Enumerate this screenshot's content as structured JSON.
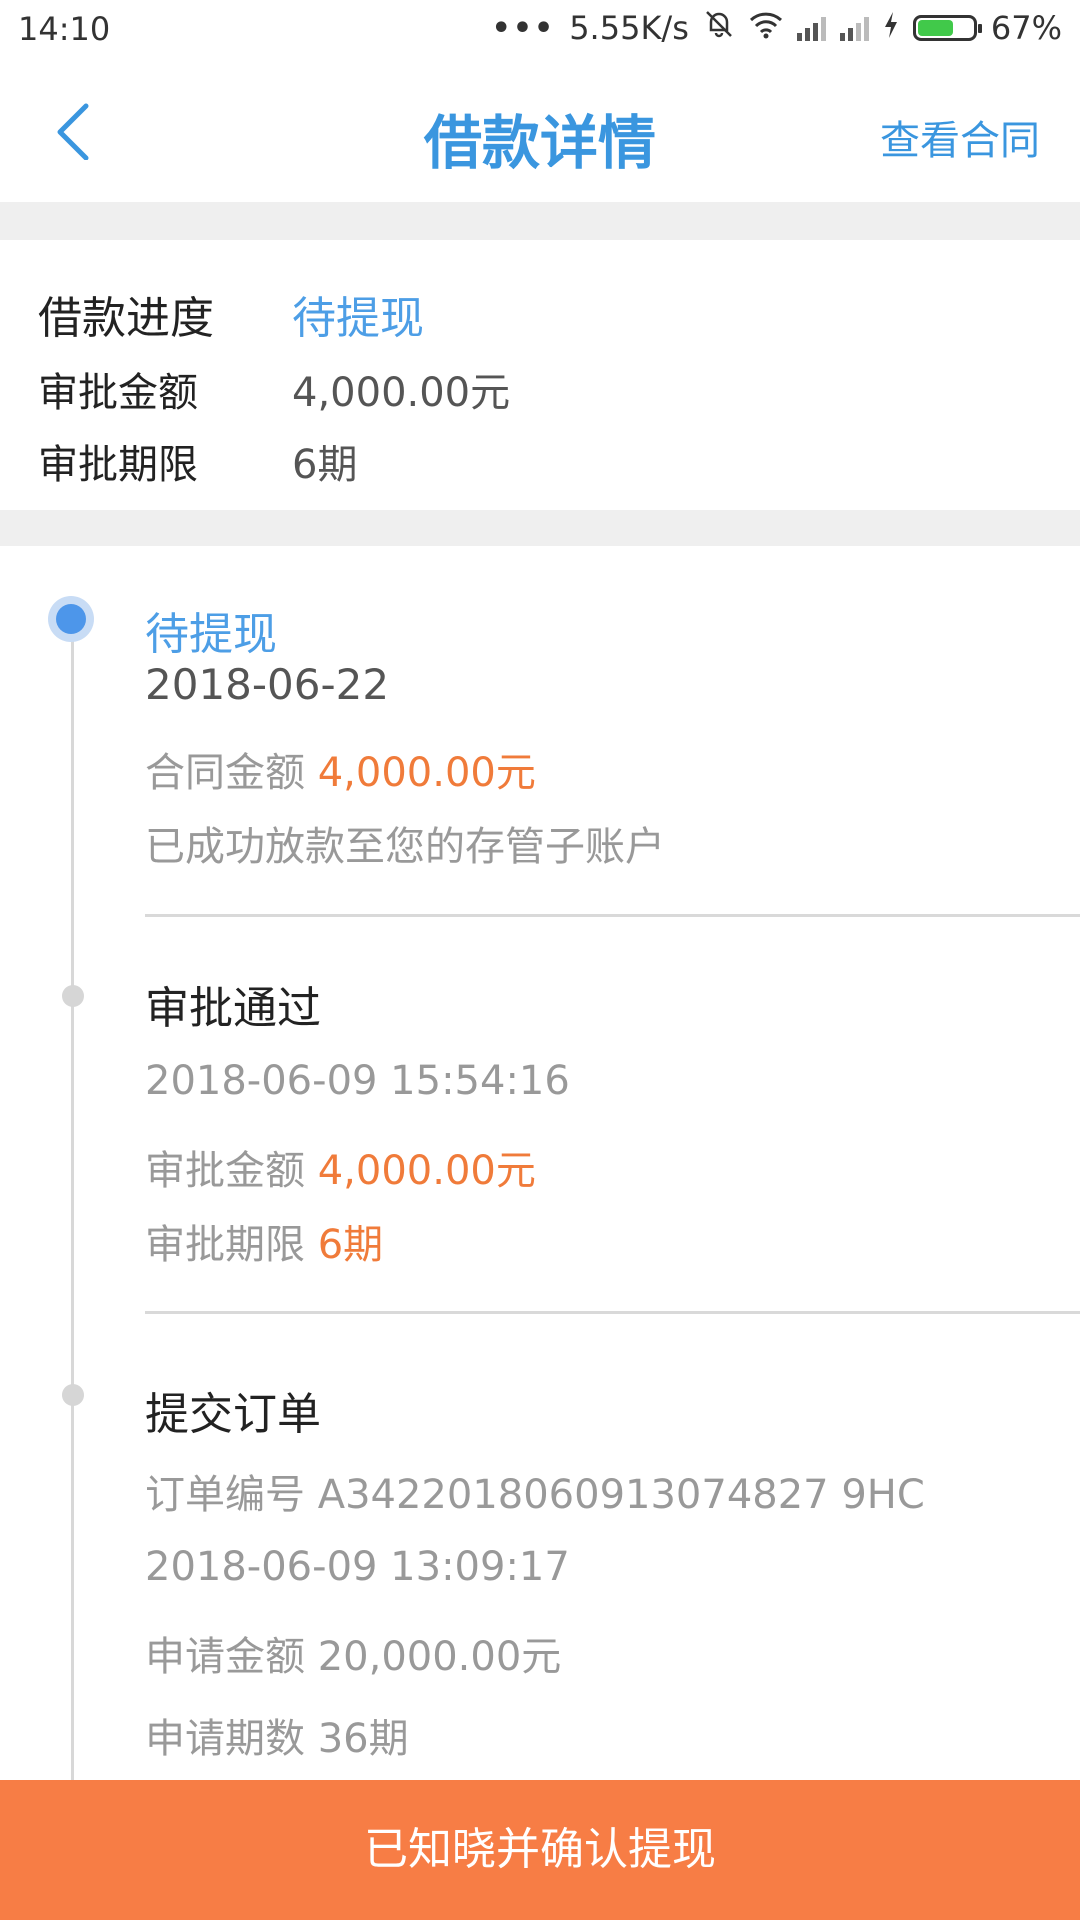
{
  "status_bar": {
    "time": "14:10",
    "dots": "•••",
    "net_speed": "5.55K/s",
    "battery_percent": "67%",
    "battery_level": 0.67,
    "icons": [
      "mute-bell-icon",
      "wifi-icon",
      "signal-icon",
      "signal-icon",
      "charging-icon",
      "battery-icon"
    ]
  },
  "nav": {
    "title": "借款详情",
    "right_link": "查看合同",
    "back_icon": "chevron-left-icon",
    "accent": "#3a96df"
  },
  "summary": {
    "progress_label": "借款进度",
    "progress_value": "待提现",
    "amount_label": "审批金额",
    "amount_value": "4,000.00元",
    "term_label": "审批期限",
    "term_value": "6期"
  },
  "timeline": {
    "step1": {
      "title": "待提现",
      "date": "2018-06-22",
      "contract_label": "合同金额",
      "contract_value": "4,000.00元",
      "note": "已成功放款至您的存管子账户"
    },
    "step2": {
      "title": "审批通过",
      "datetime": "2018-06-09 15:54:16",
      "amount_label": "审批金额",
      "amount_value": "4,000.00元",
      "term_label": "审批期限",
      "term_value": "6期"
    },
    "step3": {
      "title": "提交订单",
      "order_label": "订单编号",
      "order_value": "A3422018060913074827 9HC",
      "datetime": "2018-06-09 13:09:17",
      "apply_amount_label": "申请金额",
      "apply_amount_value": "20,000.00元",
      "apply_term_label": "申请期数",
      "apply_term_value": "36期"
    }
  },
  "confirm_button": {
    "label": "已知晓并确认提现",
    "color": "#f77d45"
  },
  "colors": {
    "highlight_orange": "#f07b3a",
    "active_blue": "#4d9ee6"
  }
}
